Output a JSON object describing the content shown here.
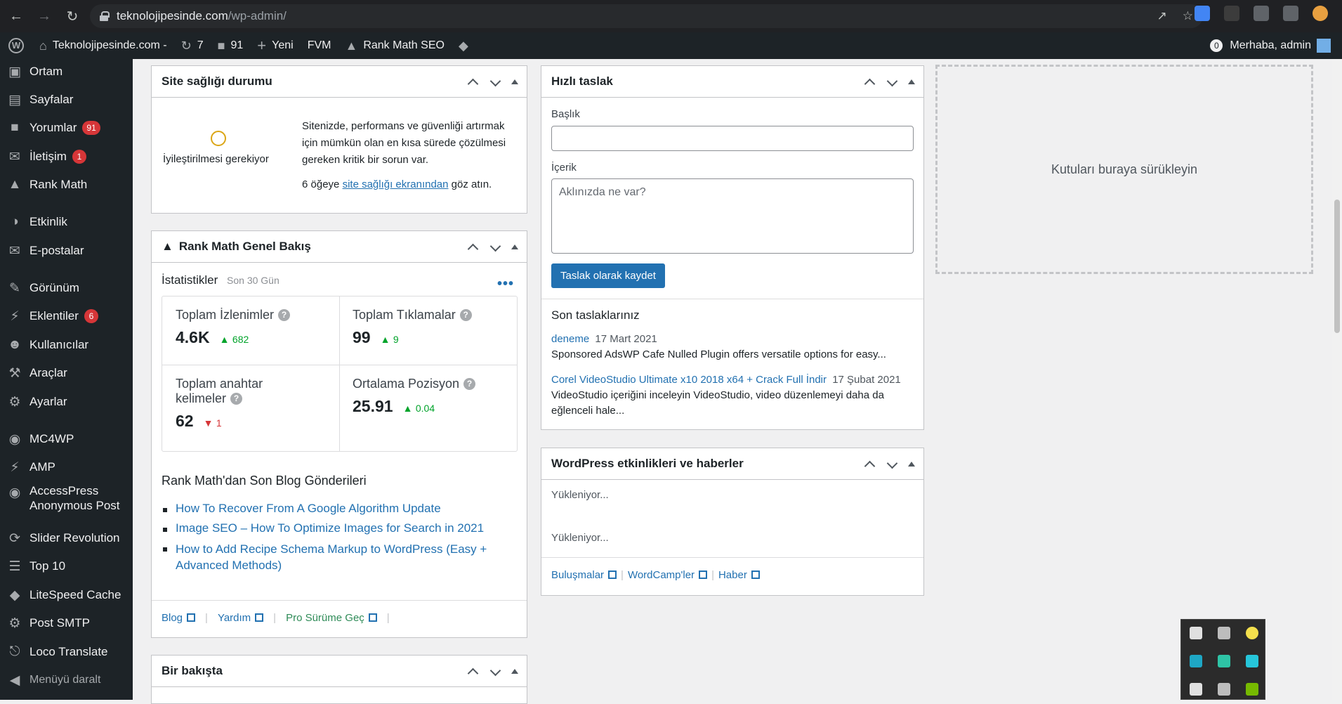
{
  "browser": {
    "url_host": "teknolojipesinde.com",
    "url_path": "/wp-admin/"
  },
  "adminbar": {
    "site_name": "Teknolojipesinde.com -",
    "updates_count": "7",
    "comments_count": "91",
    "new_label": "Yeni",
    "fvm_label": "FVM",
    "rankmath_label": "Rank Math SEO",
    "notif_count": "0",
    "greeting": "Merhaba, admin"
  },
  "sidebar": {
    "items": [
      {
        "label": "Ortam",
        "icon": "media-icon"
      },
      {
        "label": "Sayfalar",
        "icon": "pages-icon"
      },
      {
        "label": "Yorumlar",
        "icon": "comments-icon",
        "badge": "91"
      },
      {
        "label": "İletişim",
        "icon": "mail-icon",
        "badge": "1"
      },
      {
        "label": "Rank Math",
        "icon": "rankmath-icon"
      },
      {
        "label": "Etkinlik",
        "icon": "activity-icon"
      },
      {
        "label": "E-postalar",
        "icon": "email-icon"
      },
      {
        "label": "Görünüm",
        "icon": "appearance-icon"
      },
      {
        "label": "Eklentiler",
        "icon": "plugins-icon",
        "badge": "6"
      },
      {
        "label": "Kullanıcılar",
        "icon": "users-icon"
      },
      {
        "label": "Araçlar",
        "icon": "tools-icon"
      },
      {
        "label": "Ayarlar",
        "icon": "settings-icon"
      },
      {
        "label": "MC4WP",
        "icon": "mc4wp-icon"
      },
      {
        "label": "AMP",
        "icon": "amp-icon"
      },
      {
        "label": "AccessPress Anonymous Post",
        "icon": "accesspress-icon"
      },
      {
        "label": "Slider Revolution",
        "icon": "slider-icon"
      },
      {
        "label": "Top 10",
        "icon": "list-icon"
      },
      {
        "label": "LiteSpeed Cache",
        "icon": "litespeed-icon"
      },
      {
        "label": "Post SMTP",
        "icon": "gear-icon"
      },
      {
        "label": "Loco Translate",
        "icon": "translate-icon"
      }
    ],
    "collapse_label": "Menüyü daralt"
  },
  "site_health": {
    "title": "Site sağlığı durumu",
    "status": "İyileştirilmesi gerekiyor",
    "description": "Sitenizde, performans ve güvenliği artırmak için mümkün olan en kısa sürede çözülmesi gereken kritik bir sorun var.",
    "items_prefix": "6 öğeye",
    "items_link": "site sağlığı ekranından",
    "items_suffix": "göz atın."
  },
  "rankmath": {
    "title": "Rank Math Genel Bakış",
    "stats_title": "İstatistikler",
    "stats_period": "Son 30 Gün",
    "stats": [
      {
        "label": "Toplam İzlenimler",
        "value": "4.6K",
        "delta": "682",
        "dir": "up"
      },
      {
        "label": "Toplam Tıklamalar",
        "value": "99",
        "delta": "9",
        "dir": "up"
      },
      {
        "label_line1": "Toplam anahtar",
        "label_line2": "kelimeler",
        "value": "62",
        "delta": "1",
        "dir": "down"
      },
      {
        "label": "Ortalama Pozisyon",
        "value": "25.91",
        "delta": "0.04",
        "dir": "up"
      }
    ],
    "blog_title": "Rank Math'dan Son Blog Gönderileri",
    "posts": [
      "How To Recover From A Google Algorithm Update",
      "Image SEO – How To Optimize Images for Search in 2021",
      "How to Add Recipe Schema Markup to WordPress (Easy +",
      "Advanced Methods)"
    ],
    "footer_links": [
      "Blog",
      "Yardım",
      "Pro Sürüme Geç"
    ]
  },
  "glance": {
    "title": "Bir bakışta"
  },
  "quick_draft": {
    "title": "Hızlı taslak",
    "title_label": "Başlık",
    "content_label": "İçerik",
    "content_placeholder": "Aklınızda ne var?",
    "save_label": "Taslak olarak kaydet",
    "recent_title": "Son taslaklarınız",
    "drafts": [
      {
        "title": "deneme",
        "date": "17 Mart 2021",
        "excerpt": "Sponsored AdsWP Cafe Nulled Plugin offers versatile options for easy..."
      },
      {
        "title": "Corel VideoStudio Ultimate x10 2018 x64 + Crack Full İndir",
        "date": "17 Şubat 2021",
        "excerpt_line1": "VideoStudio içeriğini inceleyin VideoStudio, video düzenlemeyi daha da",
        "excerpt_line2": "eğlenceli hale..."
      }
    ]
  },
  "events": {
    "title": "WordPress etkinlikleri ve haberler",
    "loading1": "Yükleniyor...",
    "loading2": "Yükleniyor...",
    "links": [
      "Buluşmalar",
      "WordCamp'ler",
      "Haber"
    ]
  },
  "dropzone": {
    "label": "Kutuları buraya sürükleyin"
  },
  "colors": {
    "accent": "#2271b1",
    "admin_bg": "#1d2327",
    "badge": "#d63638",
    "success": "#00a32a"
  }
}
